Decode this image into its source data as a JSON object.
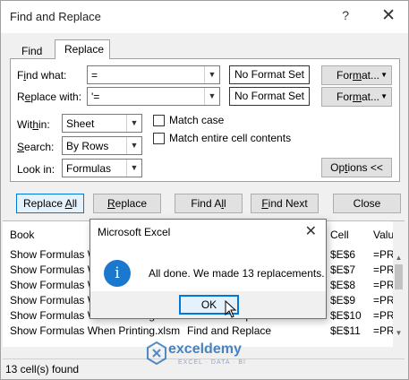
{
  "dialog": {
    "title": "Find and Replace",
    "help": "?",
    "close": "✕"
  },
  "tabs": {
    "find": "Find",
    "replace": "Replace"
  },
  "form": {
    "find_label_u": "i",
    "find_label_pre": "F",
    "find_label_post": "nd what:",
    "find_value": "=",
    "replace_label_pre": "R",
    "replace_label_u": "e",
    "replace_label_post": "place with:",
    "replace_value": "'=",
    "no_format_1": "No Format Set",
    "no_format_2": "No Format Set",
    "format_btn_1_pre": "For",
    "format_btn_1_u": "m",
    "format_btn_1_post": "at...",
    "format_btn_2_pre": "For",
    "format_btn_2_u": "m",
    "format_btn_2_post": "at...",
    "within_pre": "Wit",
    "within_u": "h",
    "within_post": "in:",
    "within_value": "Sheet",
    "search_pre": "",
    "search_u": "S",
    "search_post": "earch:",
    "search_value": "By Rows",
    "lookin_pre": "Look in:",
    "lookin_value": "Formulas",
    "match_case": "Match case",
    "match_entire": "Match entire cell contents",
    "options_pre": "Op",
    "options_u": "t",
    "options_post": "ions <<"
  },
  "buttons": {
    "replace_all_pre": "Replace ",
    "replace_all_u": "A",
    "replace_all_post": "ll",
    "replace_pre": "",
    "replace_u": "R",
    "replace_post": "eplace",
    "find_all_pre": "Find A",
    "find_all_u": "l",
    "find_all_post": "l",
    "find_next_pre": "",
    "find_next_u": "F",
    "find_next_post": "ind Next",
    "close": "Close"
  },
  "results": {
    "headers": {
      "book": "Book",
      "cell": "Cell",
      "value": "Valu"
    },
    "rows": [
      {
        "book": "Show Formulas W",
        "sheet": "",
        "cell": "$E$6",
        "value": "=PR"
      },
      {
        "book": "Show Formulas W",
        "sheet": "",
        "cell": "$E$7",
        "value": "=PR"
      },
      {
        "book": "Show Formulas W",
        "sheet": "",
        "cell": "$E$8",
        "value": "=PR"
      },
      {
        "book": "Show Formulas W",
        "sheet": "",
        "cell": "$E$9",
        "value": "=PR"
      },
      {
        "book": "Show Formulas When Printing.xlsm",
        "sheet": "Find and Replace",
        "cell": "$E$10",
        "value": "=PR"
      },
      {
        "book": "Show Formulas When Printing.xlsm",
        "sheet": "Find and Replace",
        "cell": "$E$11",
        "value": "=PR"
      }
    ],
    "status": "13 cell(s) found"
  },
  "watermark": {
    "brand": "exceldemy",
    "tagline": "EXCEL · DATA · BI"
  },
  "message_box": {
    "title": "Microsoft Excel",
    "close": "✕",
    "icon": "i",
    "text": "All done. We made 13 replacements.",
    "ok": "OK"
  },
  "colors": {
    "info_icon": "#1b78cf",
    "ok_border": "#0078d7",
    "brand": "#2c6fb7"
  }
}
